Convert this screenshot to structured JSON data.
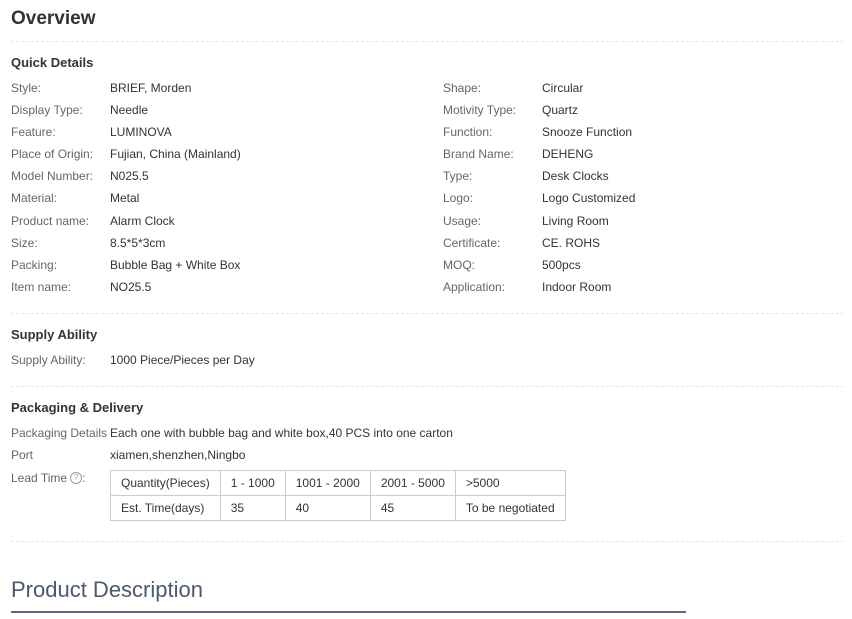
{
  "overview": {
    "title": "Overview"
  },
  "quick_details": {
    "title": "Quick Details",
    "left": [
      {
        "label": "Style:",
        "value": "BRIEF, Morden"
      },
      {
        "label": "Display Type:",
        "value": "Needle"
      },
      {
        "label": "Feature:",
        "value": "LUMINOVA"
      },
      {
        "label": "Place of Origin:",
        "value": "Fujian, China (Mainland)"
      },
      {
        "label": "Model Number:",
        "value": "N025.5"
      },
      {
        "label": "Material:",
        "value": "Metal"
      },
      {
        "label": "Product name:",
        "value": "Alarm Clock"
      },
      {
        "label": "Size:",
        "value": "8.5*5*3cm"
      },
      {
        "label": "Packing:",
        "value": "Bubble Bag + White Box"
      },
      {
        "label": "Item name:",
        "value": "NO25.5"
      }
    ],
    "right": [
      {
        "label": "Shape:",
        "value": "Circular"
      },
      {
        "label": "Motivity Type:",
        "value": "Quartz"
      },
      {
        "label": "Function:",
        "value": "Snooze Function"
      },
      {
        "label": "Brand Name:",
        "value": "DEHENG"
      },
      {
        "label": "Type:",
        "value": "Desk Clocks"
      },
      {
        "label": "Logo:",
        "value": "Logo Customized"
      },
      {
        "label": "Usage:",
        "value": "Living Room"
      },
      {
        "label": "Certificate:",
        "value": "CE. ROHS"
      },
      {
        "label": "MOQ:",
        "value": "500pcs"
      },
      {
        "label": "Application:",
        "value": "Indoor Room"
      }
    ]
  },
  "supply": {
    "title": "Supply Ability",
    "label": "Supply Ability:",
    "value": "1000 Piece/Pieces per Day"
  },
  "packaging": {
    "title": "Packaging & Delivery",
    "details_label": "Packaging Details",
    "details_value": "Each one with bubble bag and white box,40 PCS into one carton",
    "port_label": "Port",
    "port_value": "xiamen,shenzhen,Ningbo",
    "lead_time_label": "Lead Time",
    "lead_time_colon": ":",
    "help_glyph": "?",
    "lead_time_table": {
      "rows": [
        [
          "Quantity(Pieces)",
          "1 - 1000",
          "1001 - 2000",
          "2001 - 5000",
          ">5000"
        ],
        [
          "Est. Time(days)",
          "35",
          "40",
          "45",
          "To be negotiated"
        ]
      ]
    }
  },
  "description": {
    "title": "Product Description"
  }
}
